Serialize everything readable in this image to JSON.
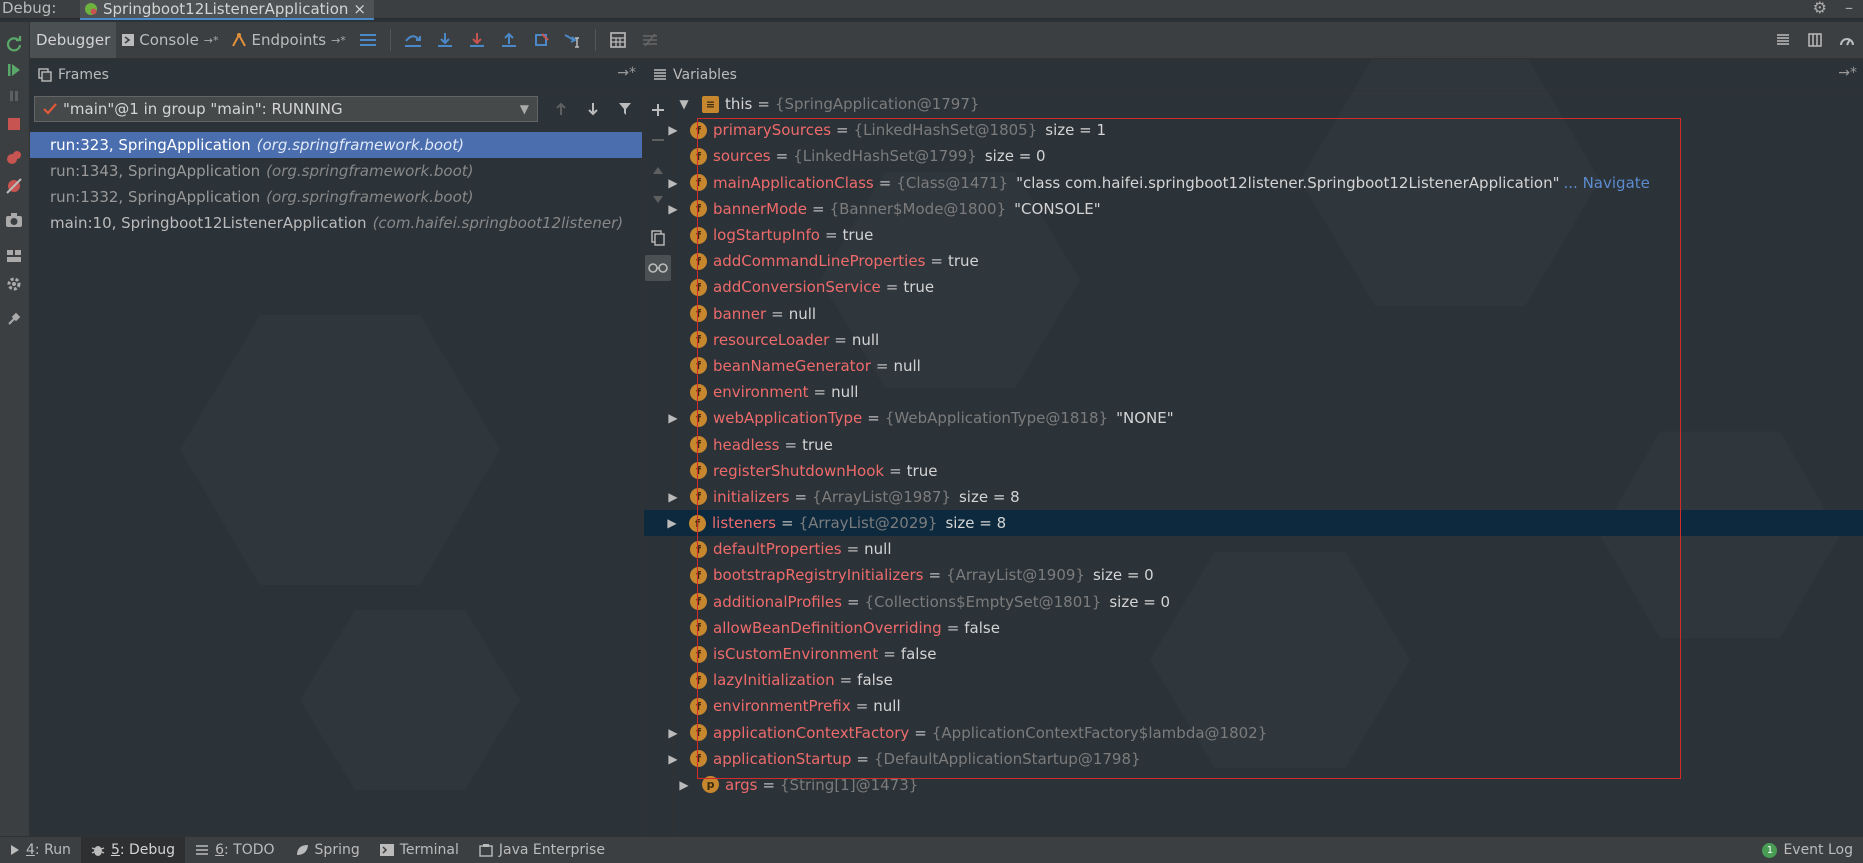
{
  "title_bar": {
    "label": "Debug:",
    "tab_title": "Springboot12ListenerApplication",
    "close_glyph": "×"
  },
  "toolbar": {
    "debugger_tab": "Debugger",
    "console_tab": "Console",
    "endpoints_tab": "Endpoints",
    "arrow_glyph": "→*"
  },
  "frames": {
    "header": "Frames",
    "thread": "\"main\"@1 in group \"main\": RUNNING",
    "items": [
      {
        "method": "run:323, SpringApplication",
        "package": "(org.springframework.boot)"
      },
      {
        "method": "run:1343, SpringApplication",
        "package": "(org.springframework.boot)"
      },
      {
        "method": "run:1332, SpringApplication",
        "package": "(org.springframework.boot)"
      },
      {
        "method": "main:10, Springboot12ListenerApplication",
        "package": "(com.haifei.springboot12listener)"
      }
    ]
  },
  "variables": {
    "header": "Variables",
    "root": {
      "name": "this",
      "ref": "{SpringApplication@1797}"
    },
    "fields": [
      {
        "name": "primarySources",
        "ref": "{LinkedHashSet@1805}",
        "value": "size = 1",
        "expandable": true
      },
      {
        "name": "sources",
        "ref": "{LinkedHashSet@1799}",
        "value": "size = 0",
        "expandable": false
      },
      {
        "name": "mainApplicationClass",
        "ref": "{Class@1471}",
        "value": "\"class com.haifei.springboot12listener.Springboot12ListenerApplication\"",
        "link": "... Navigate",
        "expandable": true
      },
      {
        "name": "bannerMode",
        "ref": "{Banner$Mode@1800}",
        "value": "\"CONSOLE\"",
        "expandable": true
      },
      {
        "name": "logStartupInfo",
        "plain": "true"
      },
      {
        "name": "addCommandLineProperties",
        "plain": "true"
      },
      {
        "name": "addConversionService",
        "plain": "true"
      },
      {
        "name": "banner",
        "plain": "null"
      },
      {
        "name": "resourceLoader",
        "plain": "null"
      },
      {
        "name": "beanNameGenerator",
        "plain": "null"
      },
      {
        "name": "environment",
        "plain": "null"
      },
      {
        "name": "webApplicationType",
        "ref": "{WebApplicationType@1818}",
        "value": "\"NONE\"",
        "expandable": true
      },
      {
        "name": "headless",
        "plain": "true"
      },
      {
        "name": "registerShutdownHook",
        "plain": "true"
      },
      {
        "name": "initializers",
        "ref": "{ArrayList@1987}",
        "value": "size = 8",
        "expandable": true
      },
      {
        "name": "listeners",
        "ref": "{ArrayList@2029}",
        "value": "size = 8",
        "expandable": true,
        "selected": true
      },
      {
        "name": "defaultProperties",
        "plain": "null"
      },
      {
        "name": "bootstrapRegistryInitializers",
        "ref": "{ArrayList@1909}",
        "value": "size = 0",
        "expandable": false
      },
      {
        "name": "additionalProfiles",
        "ref": "{Collections$EmptySet@1801}",
        "value": "size = 0",
        "expandable": false
      },
      {
        "name": "allowBeanDefinitionOverriding",
        "plain": "false"
      },
      {
        "name": "isCustomEnvironment",
        "plain": "false"
      },
      {
        "name": "lazyInitialization",
        "plain": "false"
      },
      {
        "name": "environmentPrefix",
        "plain": "null"
      },
      {
        "name": "applicationContextFactory",
        "ref": "{ApplicationContextFactory$lambda@1802}",
        "expandable": true
      },
      {
        "name": "applicationStartup",
        "ref": "{DefaultApplicationStartup@1798}",
        "expandable": true
      }
    ],
    "args": {
      "name": "args",
      "ref": "{String[1]@1473}"
    }
  },
  "status_bar": {
    "run": {
      "num": "4",
      "label": ": Run"
    },
    "debug": {
      "num": "5",
      "label": ": Debug"
    },
    "todo": {
      "num": "6",
      "label": ": TODO"
    },
    "spring": "Spring",
    "terminal": "Terminal",
    "java_enterprise": "Java Enterprise",
    "event_log": "Event Log",
    "event_count": "1"
  },
  "colors": {
    "accent": "#4b6eaf",
    "field_name": "#ee6b6b",
    "badge": "#c7872e",
    "highlight_box": "#d42a2a",
    "selected_row": "#0d293e"
  }
}
